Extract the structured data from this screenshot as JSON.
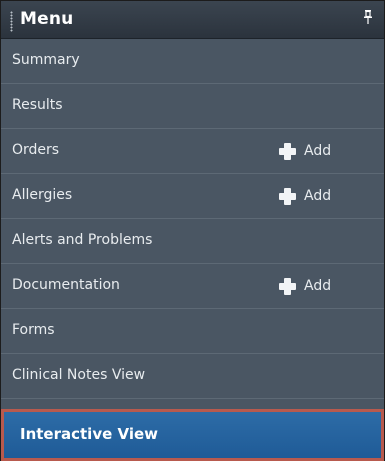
{
  "menu": {
    "title": "Menu",
    "pin_icon": "pin-icon",
    "items": [
      {
        "label": "Summary",
        "add_label": null
      },
      {
        "label": "Results",
        "add_label": null
      },
      {
        "label": "Orders",
        "add_label": "Add"
      },
      {
        "label": "Allergies",
        "add_label": "Add"
      },
      {
        "label": "Alerts and Problems",
        "add_label": null
      },
      {
        "label": "Documentation",
        "add_label": "Add"
      },
      {
        "label": "Forms",
        "add_label": null
      },
      {
        "label": "Clinical Notes View",
        "add_label": null
      }
    ],
    "active_item": {
      "label": "Interactive View"
    }
  },
  "colors": {
    "panel_bg": "#4a5663",
    "header_bg": "#2f3842",
    "active_bg": "#256aa6",
    "active_border": "#b85a4e"
  }
}
